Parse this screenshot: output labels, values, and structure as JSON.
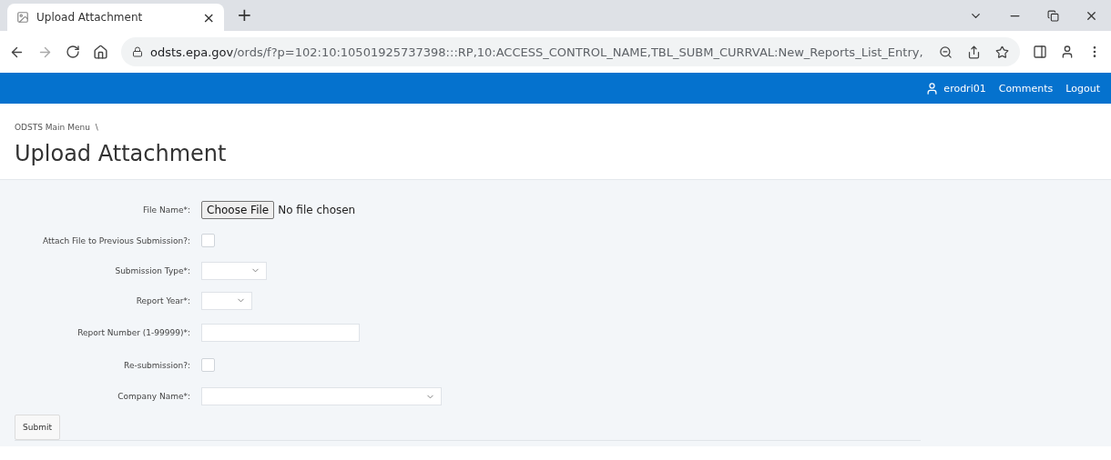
{
  "browser": {
    "tab": {
      "title": "Upload Attachment",
      "close": "×",
      "selected": true
    },
    "new_tab": "+",
    "url": {
      "host": "odsts.epa.gov",
      "path": "/ords/f?p=102:10:10501925737398:::RP,10:ACCESS_CONTROL_NAME,TBL_SUBM_CURRVAL:New_Reports_List_Entry,"
    }
  },
  "nav": {
    "user": "erodri01",
    "links": [
      "Comments",
      "Logout"
    ]
  },
  "breadcrumb": [
    "ODSTS Main Menu",
    "\\"
  ],
  "page_title": "Upload Attachment",
  "form": {
    "fields": [
      {
        "kind": "file",
        "label": "File Name*:",
        "button": "Choose File",
        "status": "No file chosen"
      },
      {
        "kind": "checkbox",
        "label": "Attach File to Previous Submission?:",
        "checked": false
      },
      {
        "kind": "select",
        "label": "Submission Type*:"
      },
      {
        "kind": "select",
        "label": "Report Year*:"
      },
      {
        "kind": "text",
        "label": "Report Number (1-99999)*:"
      },
      {
        "kind": "checkbox",
        "label": "Re-submission?:",
        "checked": false
      },
      {
        "kind": "select",
        "label": "Company Name*:"
      }
    ],
    "submit": "Submit"
  }
}
